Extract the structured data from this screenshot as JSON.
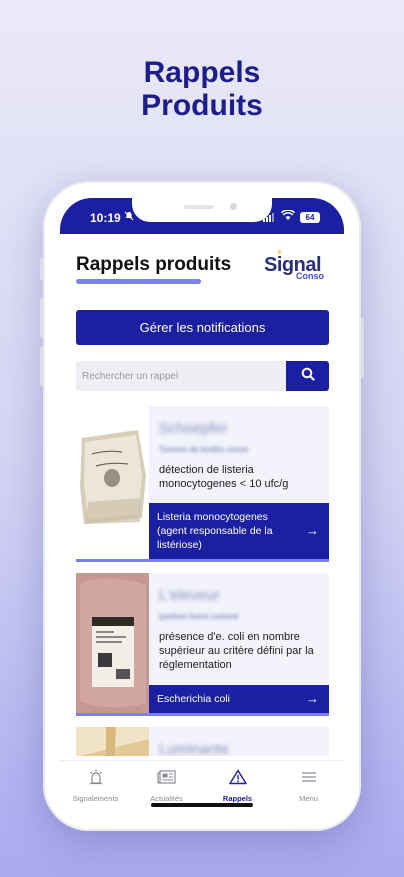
{
  "promo": {
    "title_line1": "Rappels",
    "title_line2": "Produits"
  },
  "status_bar": {
    "time": "10:19",
    "battery": "64"
  },
  "header": {
    "title": "Rappels produits",
    "logo_word": "Signal",
    "logo_sub": "Conso"
  },
  "notifications_button": {
    "label": "Gérer les notifications"
  },
  "search": {
    "placeholder": "Rechercher un rappel",
    "icon": "search-icon"
  },
  "recalls": [
    {
      "brand": "Schoepfer",
      "product": "Tomme de brebis corse",
      "description": "détection de listeria monocytogenes < 10 ufc/g",
      "risk": "Listeria monocytogenes (agent responsable de la listériose)"
    },
    {
      "brand": "L'eleveur",
      "product": "jambon fumé cuisiné",
      "description": "présence d'e. coli en nombre supérieur au critère défini par la réglementation",
      "risk": "Escherichia coli"
    },
    {
      "brand": "Luminante",
      "product": "",
      "description": "",
      "risk": ""
    }
  ],
  "tabs": [
    {
      "label": "Signalements",
      "icon": "alarm-icon",
      "active": false
    },
    {
      "label": "Actualités",
      "icon": "newspaper-icon",
      "active": false
    },
    {
      "label": "Rappels",
      "icon": "warning-icon",
      "active": true
    },
    {
      "label": "Menu",
      "icon": "hamburger-icon",
      "active": false
    }
  ],
  "colors": {
    "primary": "#1b1fa1",
    "accent": "#7b7ef5",
    "background_gradient_end": "#a9a9f0"
  }
}
